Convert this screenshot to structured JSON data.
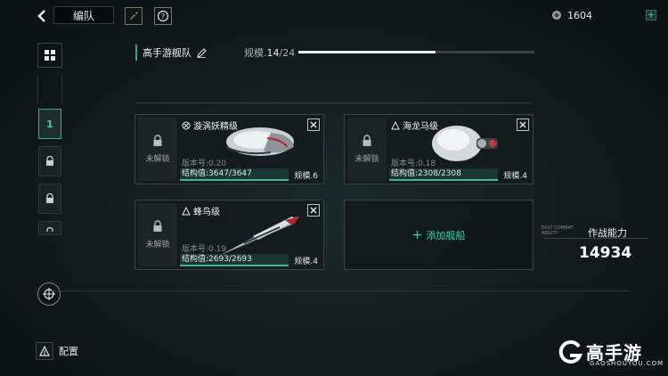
{
  "header": {
    "title": "编队",
    "currency_value": "1604",
    "currency_plus": "+"
  },
  "fleet": {
    "name": "高手游舰队",
    "scale_label": "规模.",
    "scale_current": "14",
    "scale_max": "/24",
    "scale_ratio": 0.58
  },
  "slots": {
    "active_label": "1"
  },
  "ships": [
    {
      "name": "漩涡妖精级",
      "lock_text": "未解锁",
      "version": "版本号:0.20",
      "structure": "结构值:3647/3647",
      "scale": "规模.6"
    },
    {
      "name": "海龙马级",
      "lock_text": "未解锁",
      "version": "版本号:0.18",
      "structure": "结构值:2308/2308",
      "scale": "规模.4"
    },
    {
      "name": "蜂鸟级",
      "lock_text": "未解锁",
      "version": "版本号:0.19",
      "structure": "结构值:2693/2693",
      "scale": "规模.4"
    }
  ],
  "add_ship": {
    "icon": "+",
    "label": "添加舰船"
  },
  "power": {
    "label": "作战能力",
    "value": "14934",
    "tag": "EAST COMBAT ABILITY"
  },
  "config": {
    "label": "配置"
  },
  "watermark": {
    "brand": "高手游",
    "domain": "GAOSHOUYOU.COM"
  },
  "colors": {
    "accent": "#3bd6a6",
    "background": "#141c1d"
  }
}
